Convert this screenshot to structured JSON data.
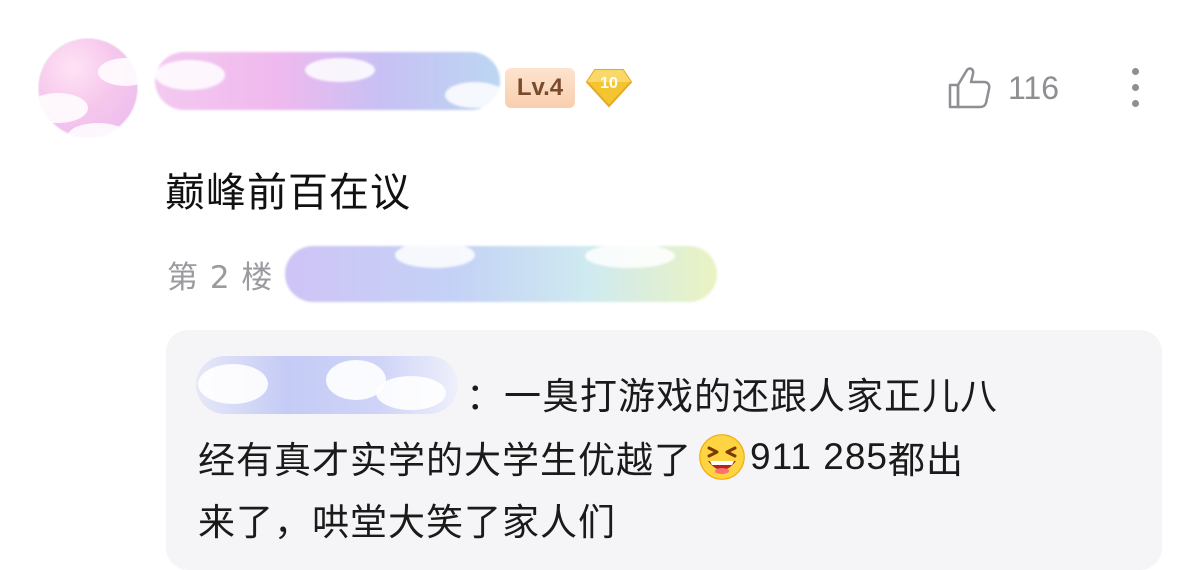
{
  "header": {
    "level_badge": "Lv.4",
    "honor_badge_value": "10",
    "like_count": "116"
  },
  "comment": {
    "text": "巅峰前百在议",
    "floor": "第 2 楼"
  },
  "reply": {
    "line1": "：一臭打游戏的还跟人家正儿八",
    "line2_pre": "经有真才实学的大学生优越了",
    "line2_post_numbers": "911 285",
    "line2_post_text": " 都出",
    "line3": "来了，哄堂大笑了家人们"
  },
  "colors": {
    "level_bg": "#fde3cf",
    "level_text": "#7a4a2c",
    "honor_badge": "#f5c431",
    "muted_text": "#8e8e93",
    "reply_bg": "#f5f5f7"
  },
  "icons": {
    "like": "thumbs-up-icon",
    "more": "more-vertical-icon",
    "emoji": "grinning-squinting-emoji"
  }
}
